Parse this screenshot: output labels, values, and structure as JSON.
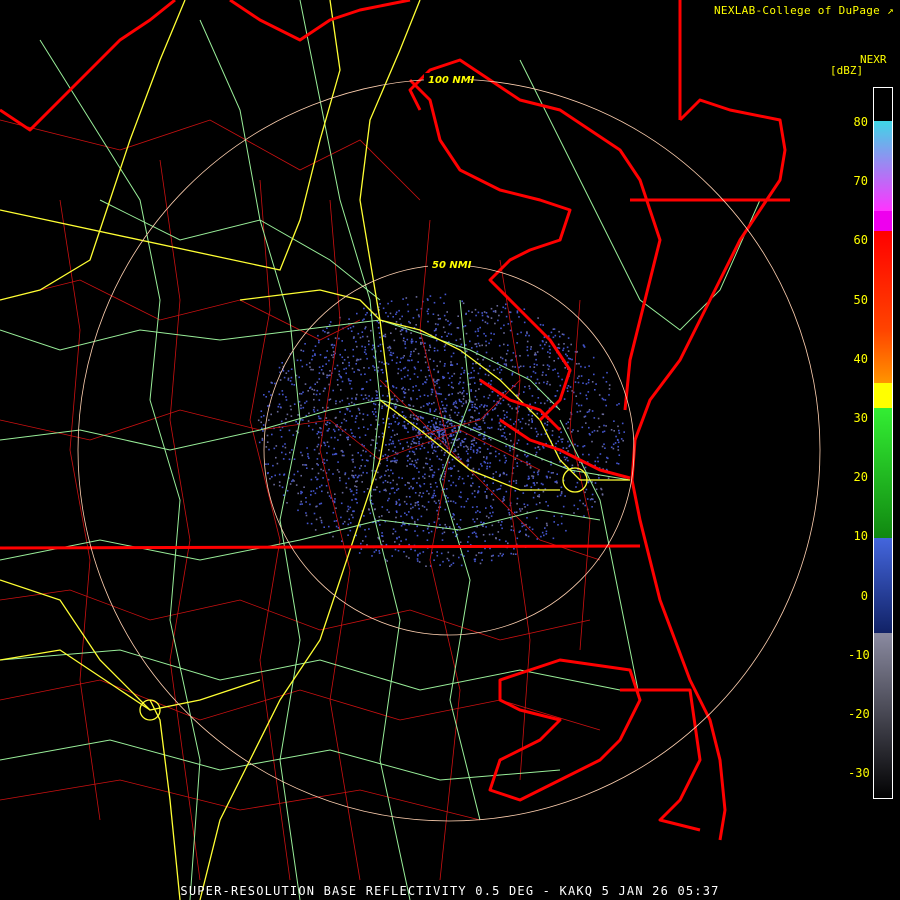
{
  "credit": "NEXLAB-College of DuPage",
  "credit_icon": "external-link-icon",
  "product_title": "SUPER-RESOLUTION BASE REFLECTIVITY 0.5 DEG - KAKQ 5 JAN 26 05:37",
  "radar": {
    "site": "KAKQ",
    "rings": [
      "50 NMI",
      "100 NMI"
    ]
  },
  "scale": {
    "title": "NEXR",
    "unit": "[dBZ]",
    "ticks": [
      "80",
      "70",
      "60",
      "50",
      "40",
      "30",
      "20",
      "10",
      "0",
      "-10",
      "-20",
      "-30"
    ],
    "colors": {
      "cyan": "#3fd6e6",
      "magenta": "#ff33ff",
      "red": "#ff0000",
      "orange": "#ff8800",
      "yellow": "#ffff00",
      "green": "#22cc22",
      "blue": "#3355cc",
      "gray": "#6a6a7a"
    }
  },
  "map_colors": {
    "state_borders": "#ff0000",
    "county_borders": "#cc1111",
    "interstates": "#ffff33",
    "highways": "#99ee99",
    "range_rings": "#ffd0b0",
    "echo": "#4455cc"
  }
}
